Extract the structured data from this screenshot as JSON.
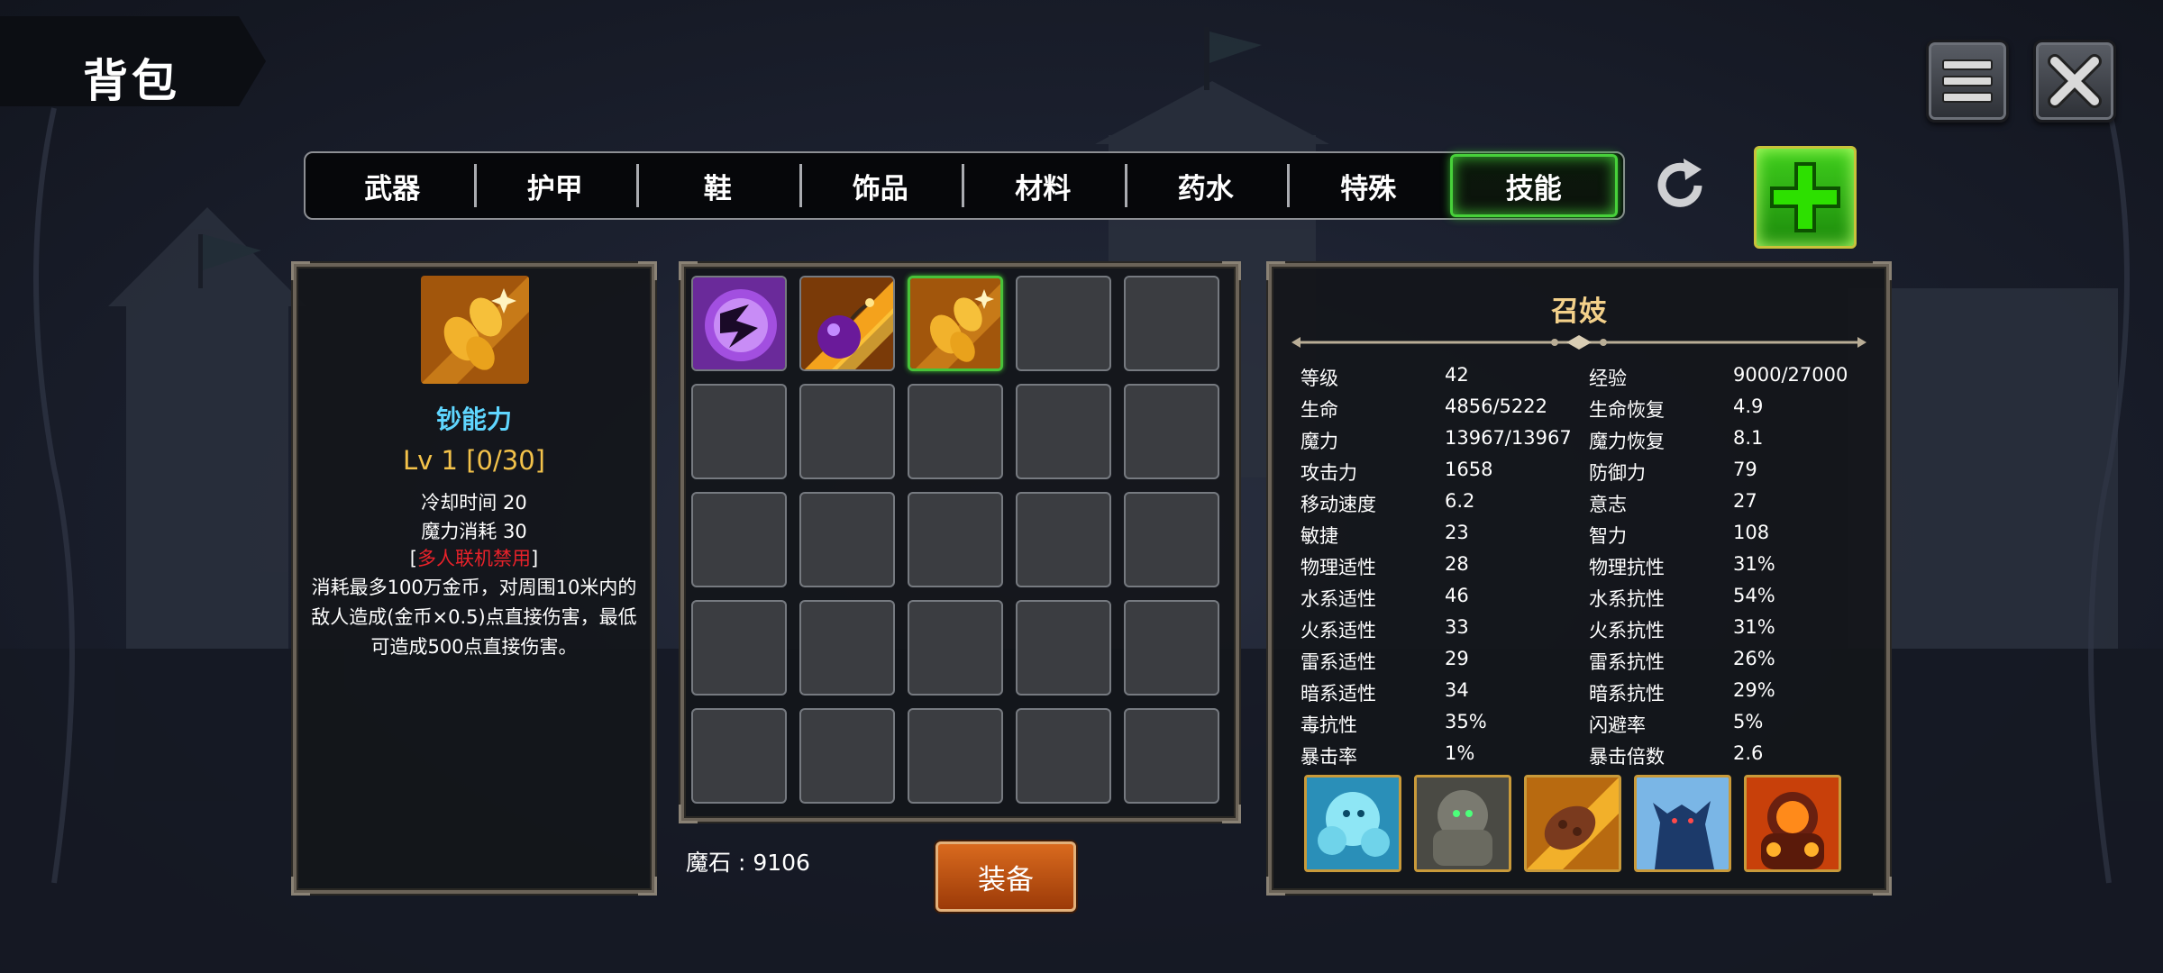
{
  "title": "背包",
  "tabs": [
    "武器",
    "护甲",
    "鞋",
    "饰品",
    "材料",
    "药水",
    "特殊",
    "技能"
  ],
  "active_tab": "技能",
  "detail": {
    "name": "钞能力",
    "level": "Lv 1 [0/30]",
    "cooldown": "冷却时间 20",
    "mana_cost": "魔力消耗 30",
    "bracket_open": "[",
    "warning": "多人联机禁用",
    "bracket_close": "]",
    "description": "消耗最多100万金币，对周围10米内的敌人造成(金币×0.5)点直接伤害，最低可造成500点直接伤害。"
  },
  "currency": "魔石 : 9106",
  "equip_label": "装备",
  "hero": {
    "name": "召妓",
    "stats": [
      [
        "等级",
        "42",
        "经验",
        "9000/27000"
      ],
      [
        "生命",
        "4856/5222",
        "生命恢复",
        "4.9"
      ],
      [
        "魔力",
        "13967/13967",
        "魔力恢复",
        "8.1"
      ],
      [
        "攻击力",
        "1658",
        "防御力",
        "79"
      ],
      [
        "移动速度",
        "6.2",
        "意志",
        "27"
      ],
      [
        "敏捷",
        "23",
        "智力",
        "108"
      ],
      [
        "物理适性",
        "28",
        "物理抗性",
        "31%"
      ],
      [
        "水系适性",
        "46",
        "水系抗性",
        "54%"
      ],
      [
        "火系适性",
        "33",
        "火系抗性",
        "31%"
      ],
      [
        "雷系适性",
        "29",
        "雷系抗性",
        "26%"
      ],
      [
        "暗系适性",
        "34",
        "暗系抗性",
        "29%"
      ],
      [
        "毒抗性",
        "35%",
        "闪避率",
        "5%"
      ],
      [
        "暴击率",
        "1%",
        "暴击倍数",
        "2.6"
      ]
    ]
  },
  "colors": {
    "active_tab_glow": "#47d13a",
    "skill_name": "#5fd6ff",
    "level_text": "#f3c24a",
    "warning": "#e8222a",
    "hero_name": "#f3d08a",
    "equip_button": "#c4561a"
  },
  "icons": {
    "skill_slots": [
      "purple-rune-skill-icon",
      "bomb-skill-icon",
      "gold-coin-skill-icon"
    ],
    "summons": [
      "ice-golem-icon",
      "stone-golem-icon",
      "rock-fist-icon",
      "shadow-beast-icon",
      "fire-golem-icon"
    ]
  }
}
